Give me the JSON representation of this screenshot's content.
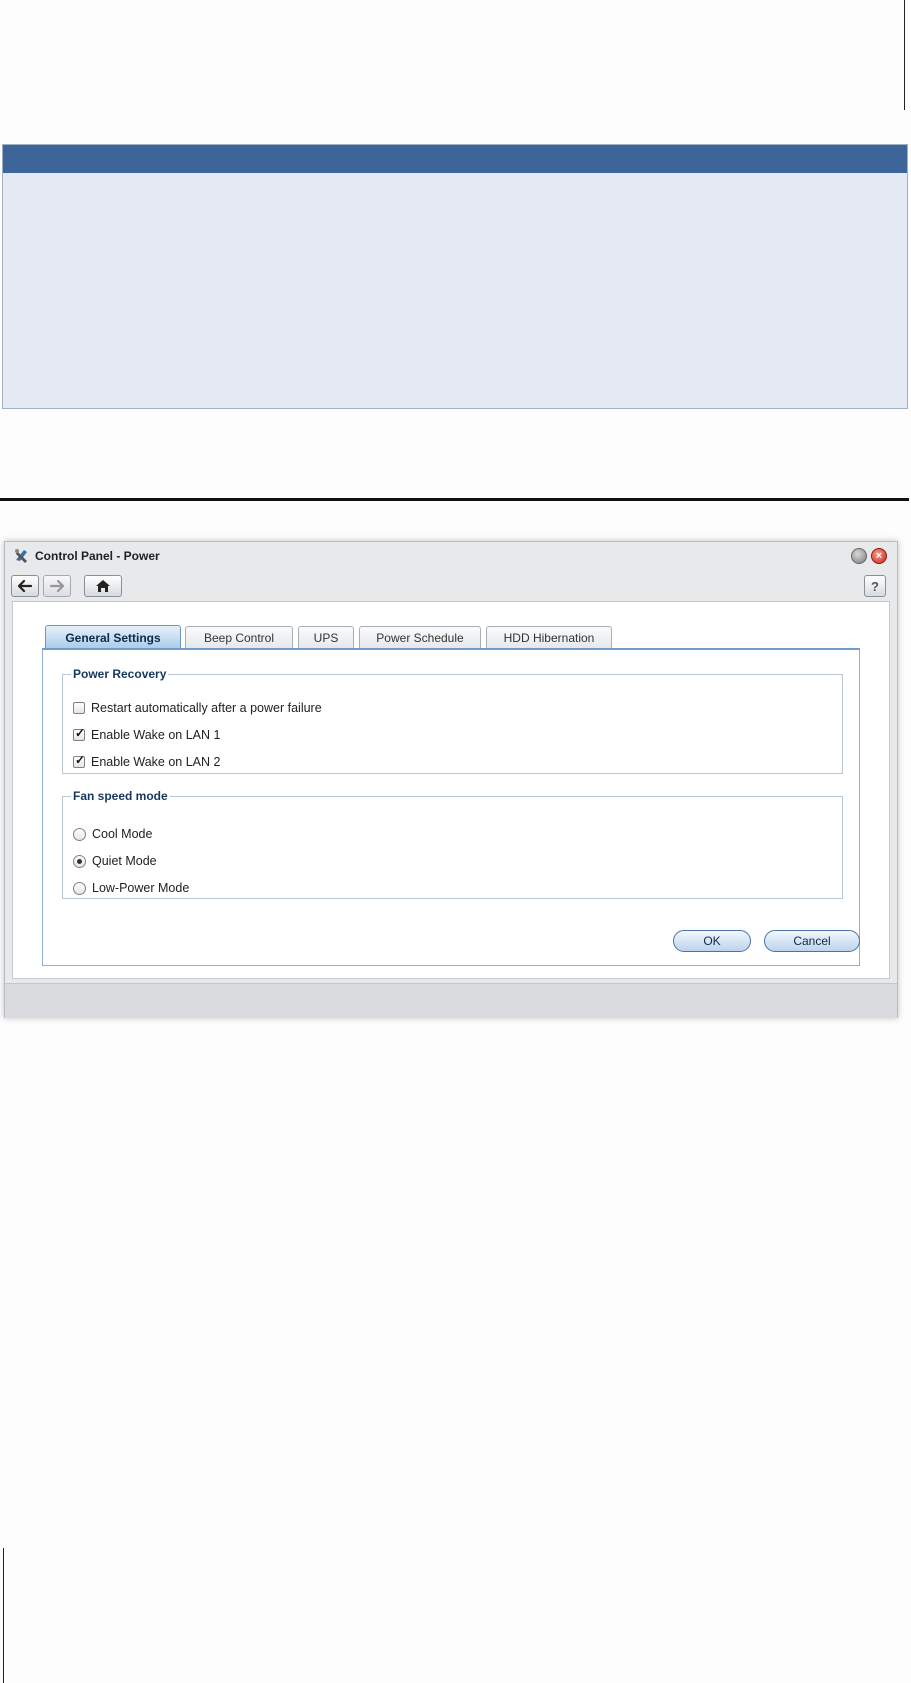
{
  "window": {
    "title": "Control Panel - Power",
    "help_label": "?",
    "close_label": "×"
  },
  "toolbar": {
    "back_icon": "arrow-left-icon",
    "forward_icon": "arrow-right-icon",
    "home_icon": "home-icon"
  },
  "tabs": [
    {
      "label": "General Settings",
      "active": true
    },
    {
      "label": "Beep Control",
      "active": false
    },
    {
      "label": "UPS",
      "active": false
    },
    {
      "label": "Power Schedule",
      "active": false
    },
    {
      "label": "HDD Hibernation",
      "active": false
    }
  ],
  "power_recovery": {
    "legend": "Power Recovery",
    "options": [
      {
        "label": "Restart automatically after a power failure",
        "checked": false
      },
      {
        "label": "Enable Wake on LAN 1",
        "checked": true
      },
      {
        "label": "Enable Wake on LAN 2",
        "checked": true
      }
    ]
  },
  "fan_speed": {
    "legend": "Fan speed mode",
    "options": [
      {
        "label": "Cool Mode",
        "selected": false
      },
      {
        "label": "Quiet Mode",
        "selected": true
      },
      {
        "label": "Low-Power Mode",
        "selected": false
      }
    ]
  },
  "buttons": {
    "ok": "OK",
    "cancel": "Cancel"
  },
  "colors": {
    "note_header": "#3d6599",
    "note_body": "#e4e9f4",
    "tab_active": "#a9cbe9"
  }
}
